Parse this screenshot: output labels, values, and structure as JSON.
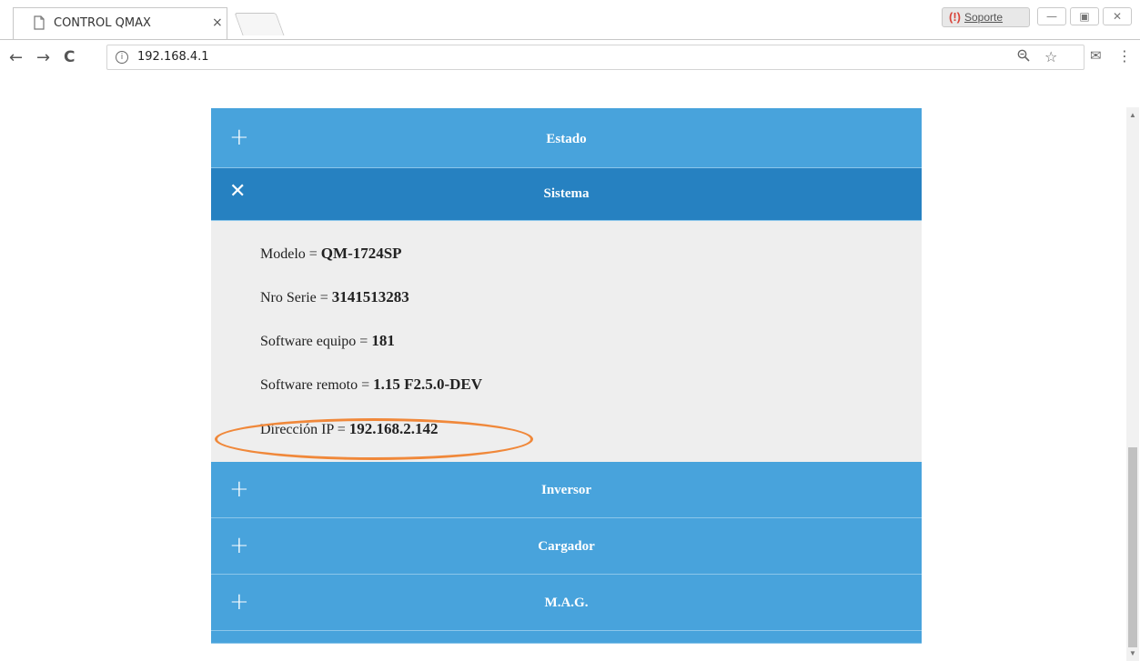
{
  "tab": {
    "title": "CONTROL QMAX",
    "close": "×"
  },
  "extension": {
    "label": "Soporte",
    "icon": "(!)"
  },
  "window_buttons": [
    "—",
    "▣",
    "✕"
  ],
  "address_bar": {
    "url": "192.168.4.1"
  },
  "nav": {
    "back": "←",
    "forward": "→",
    "reload": "C"
  },
  "accordion": [
    {
      "title": "Estado",
      "sign": "+"
    },
    {
      "title": "Sistema",
      "sign": "✕"
    },
    {
      "title": "Inversor",
      "sign": "+"
    },
    {
      "title": "Cargador",
      "sign": "+"
    },
    {
      "title": "M.A.G.",
      "sign": "+"
    }
  ],
  "sistema": [
    {
      "label": "Modelo = ",
      "value": "QM-1724SP"
    },
    {
      "label": "Nro Serie = ",
      "value": "3141513283"
    },
    {
      "label": "Software equipo = ",
      "value": "181"
    },
    {
      "label": "Software remoto = ",
      "value": "1.15 F2.5.0-DEV"
    },
    {
      "label": "Dirección IP = ",
      "value": "192.168.2.142"
    }
  ],
  "colors": {
    "header": "#48a3dc",
    "header_open": "#2681c1",
    "highlight": "#f0883a"
  }
}
